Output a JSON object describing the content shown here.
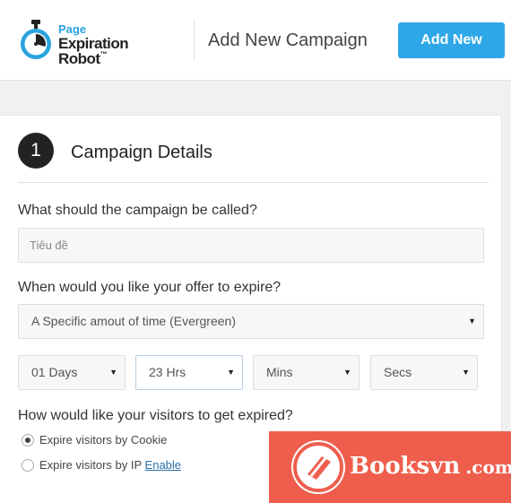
{
  "brand": {
    "logo_small": "Page",
    "logo_big": "Expiration Robot",
    "logo_tm": "™",
    "accent_color": "#2ea7e8"
  },
  "header": {
    "title": "Add New Campaign",
    "add_new_label": "Add New"
  },
  "section": {
    "step_number": "1",
    "title": "Campaign Details"
  },
  "campaign_name": {
    "question": "What should the campaign be called?",
    "placeholder": "Tiêu đề",
    "value": ""
  },
  "expiry": {
    "question": "When would you like your offer to expire?",
    "type_selected": "A Specific amout of time (Evergreen)",
    "days": "01 Days",
    "hours": "23 Hrs",
    "mins": "Mins",
    "secs": "Secs"
  },
  "visitor_expiry": {
    "question": "How would like your visitors to get expired?",
    "options": [
      {
        "label": "Expire visitors by Cookie",
        "checked": true
      },
      {
        "label": "Expire visitors by IP",
        "checked": false,
        "link": "Enable"
      }
    ]
  },
  "watermark": {
    "text": "Booksvn",
    "suffix": ".com",
    "color": "#ef5e4d"
  },
  "icons": [
    "stopwatch-logo-icon",
    "caret-down-icon",
    "radio-icon",
    "booksvn-logo-icon"
  ]
}
